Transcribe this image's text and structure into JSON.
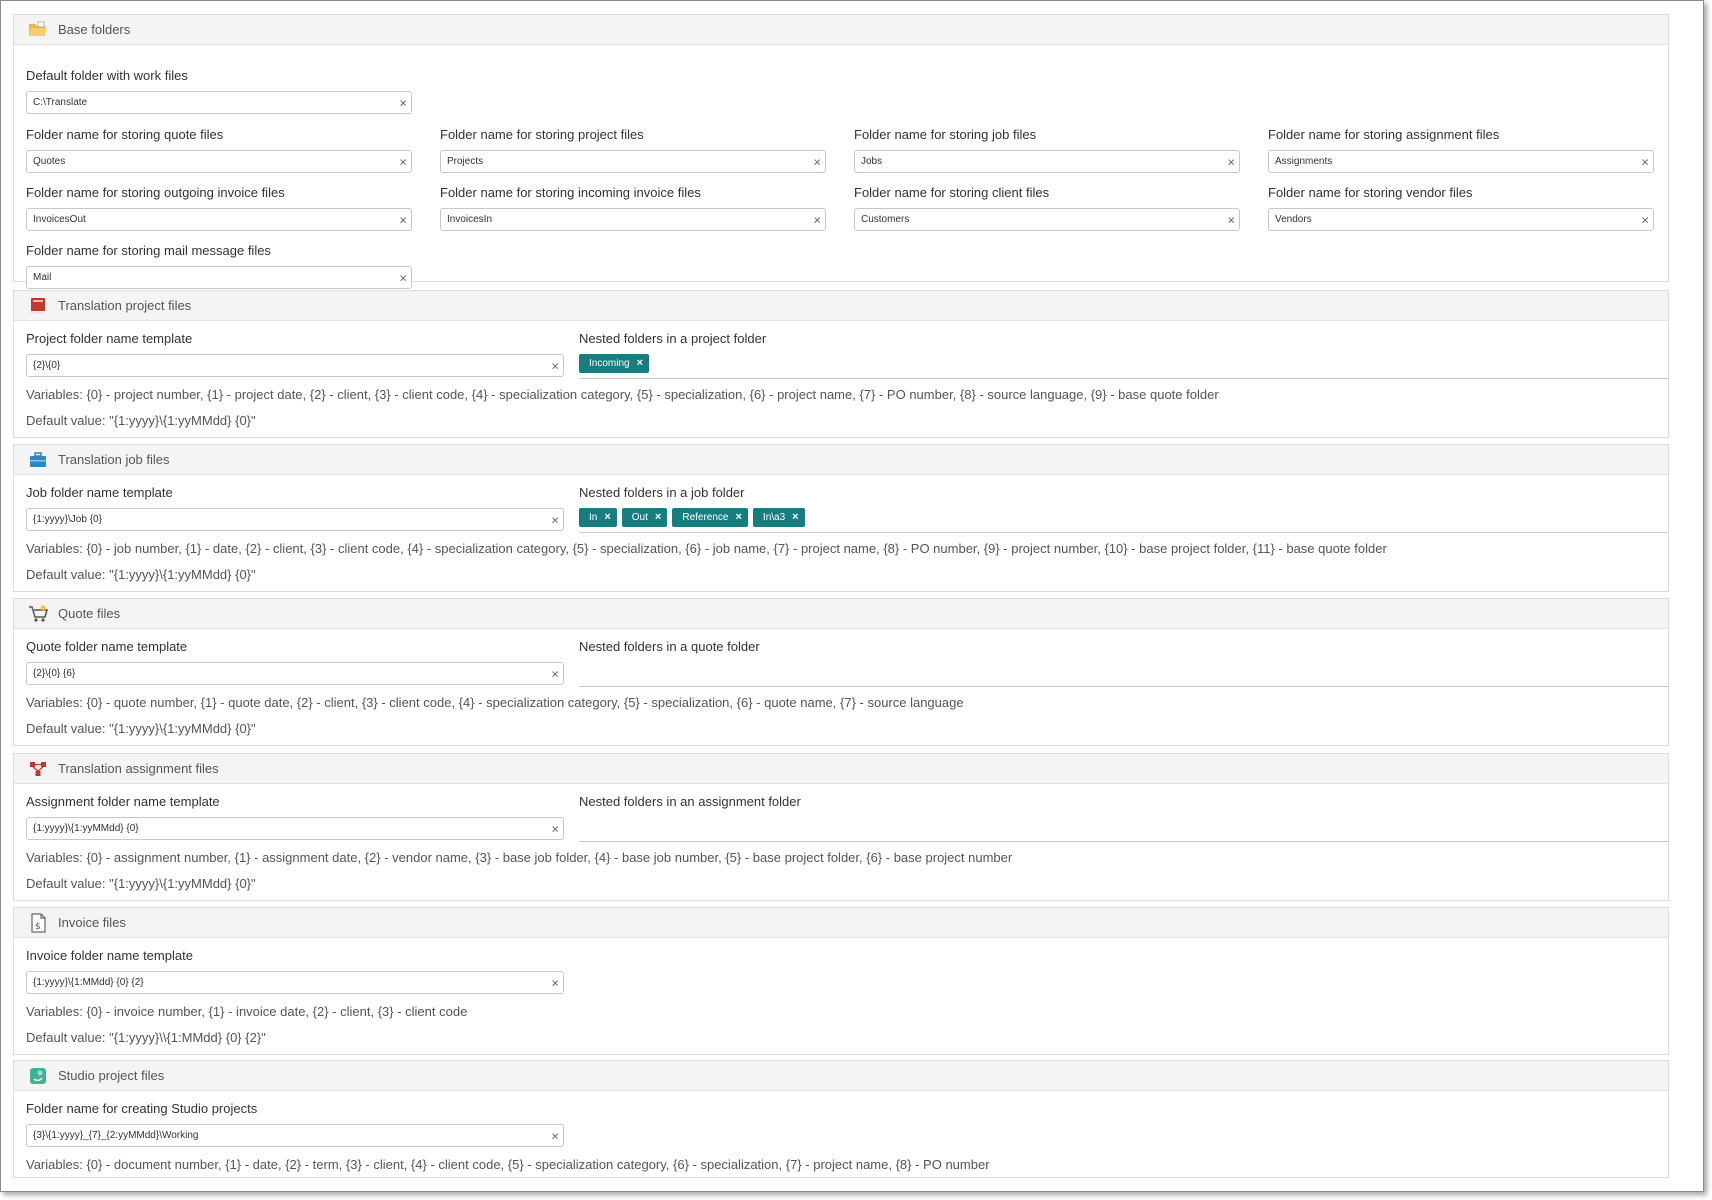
{
  "base": {
    "title": "Base folders",
    "default_folder_label": "Default folder with work files",
    "default_folder_value": "C:\\Translate",
    "fields": [
      {
        "label": "Folder name for storing quote files",
        "value": "Quotes"
      },
      {
        "label": "Folder name for storing project files",
        "value": "Projects"
      },
      {
        "label": "Folder name for storing job files",
        "value": "Jobs"
      },
      {
        "label": "Folder name for storing assignment files",
        "value": "Assignments"
      },
      {
        "label": "Folder name for storing outgoing invoice files",
        "value": "InvoicesOut"
      },
      {
        "label": "Folder name for storing incoming invoice files",
        "value": "InvoicesIn"
      },
      {
        "label": "Folder name for storing client files",
        "value": "Customers"
      },
      {
        "label": "Folder name for storing vendor files",
        "value": "Vendors"
      },
      {
        "label": "Folder name for storing mail message files",
        "value": "Mail"
      }
    ]
  },
  "project": {
    "title": "Translation project files",
    "template_label": "Project folder name template",
    "template_value": "{2}\\{0}",
    "nested_label": "Nested folders in a project folder",
    "tags": [
      "Incoming"
    ],
    "variables": "Variables: {0} - project number, {1} - project date, {2} - client, {3} - client code, {4} - specialization category, {5} - specialization, {6} - project name, {7} - PO number, {8} - source language, {9} - base quote folder",
    "default": "Default value: \"{1:yyyy}\\{1:yyMMdd} {0}\""
  },
  "job": {
    "title": "Translation job files",
    "template_label": "Job folder name template",
    "template_value": "{1:yyyy}\\Job {0}",
    "nested_label": "Nested folders in a job folder",
    "tags": [
      "In",
      "Out",
      "Reference",
      "In\\a3"
    ],
    "variables": "Variables: {0} - job number, {1} - date, {2} - client, {3} - client code, {4} - specialization category, {5} - specialization, {6} - job name, {7} - project name, {8} - PO number, {9} - project number, {10} - base project folder, {11} - base quote folder",
    "default": "Default value: \"{1:yyyy}\\{1:yyMMdd} {0}\""
  },
  "quote": {
    "title": "Quote files",
    "template_label": "Quote folder name template",
    "template_value": "{2}\\{0} {6}",
    "nested_label": "Nested folders in a quote folder",
    "variables": "Variables: {0} - quote number, {1} - quote date, {2} - client, {3} - client code, {4} - specialization category, {5} - specialization, {6} - quote name, {7} - source language",
    "default": "Default value: \"{1:yyyy}\\{1:yyMMdd} {0}\""
  },
  "assignment": {
    "title": "Translation assignment files",
    "template_label": "Assignment folder name template",
    "template_value": "{1:yyyy}\\{1:yyMMdd} {0}",
    "nested_label": "Nested folders in an assignment folder",
    "variables": "Variables: {0} - assignment number, {1} - assignment date, {2} - vendor name, {3} - base job folder, {4} - base job number, {5} - base project folder, {6} - base project number",
    "default": "Default value: \"{1:yyyy}\\{1:yyMMdd} {0}\""
  },
  "invoice": {
    "title": "Invoice files",
    "template_label": "Invoice folder name template",
    "template_value": "{1:yyyy}\\{1:MMdd} {0} {2}",
    "variables": "Variables: {0} - invoice number, {1} - invoice date, {2} - client, {3} - client code",
    "default": "Default value: \"{1:yyyy}\\\\{1:MMdd} {0} {2}\""
  },
  "studio": {
    "title": "Studio project files",
    "template_label": "Folder name for creating Studio projects",
    "template_value": "{3}\\{1:yyyy}_{7}_{2:yyMMdd}\\Working",
    "variables": "Variables: {0} - document number, {1} - date, {2} - term, {3} - client, {4} - client code, {5} - specialization category, {6} - specialization, {7} - project name, {8} - PO number"
  },
  "clear_glyph": "×",
  "colors": {
    "tag": "#177d7e",
    "header_bg": "#f4f4f4"
  }
}
